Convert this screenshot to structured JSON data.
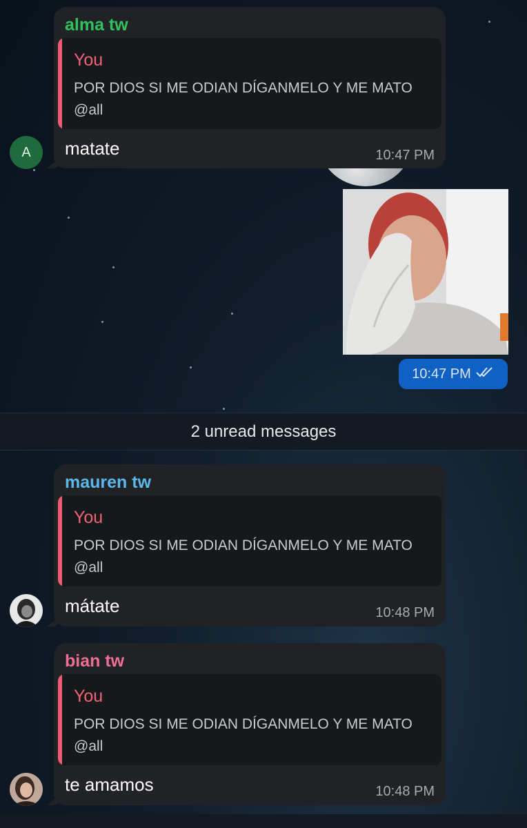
{
  "colors": {
    "alma_name": "#2fc25f",
    "mauren_name": "#5ab8ea",
    "bian_name": "#ef6f94",
    "quote_accent": "#ed5c72",
    "own_bubble": "#1160c4"
  },
  "messages": [
    {
      "sender": "alma tw",
      "avatar_letter": "A",
      "quote_author": "You",
      "quote_text": "POR DIOS SI ME ODIAN DÍGANMELO Y ME MATO @all",
      "text": "matate",
      "time": "10:47 PM"
    },
    {
      "sender": "mauren tw",
      "quote_author": "You",
      "quote_text": "POR DIOS SI ME ODIAN DÍGANMELO Y ME MATO @all",
      "text": "mátate",
      "time": "10:48 PM"
    },
    {
      "sender": "bian tw",
      "quote_author": "You",
      "quote_text": "POR DIOS SI ME ODIAN DÍGANMELO Y ME MATO @all",
      "text": "te amamos",
      "time": "10:48 PM"
    }
  ],
  "own_photo": {
    "time": "10:47 PM",
    "status_icon": "double-check-icon"
  },
  "divider": {
    "unread_label": "2 unread messages"
  }
}
